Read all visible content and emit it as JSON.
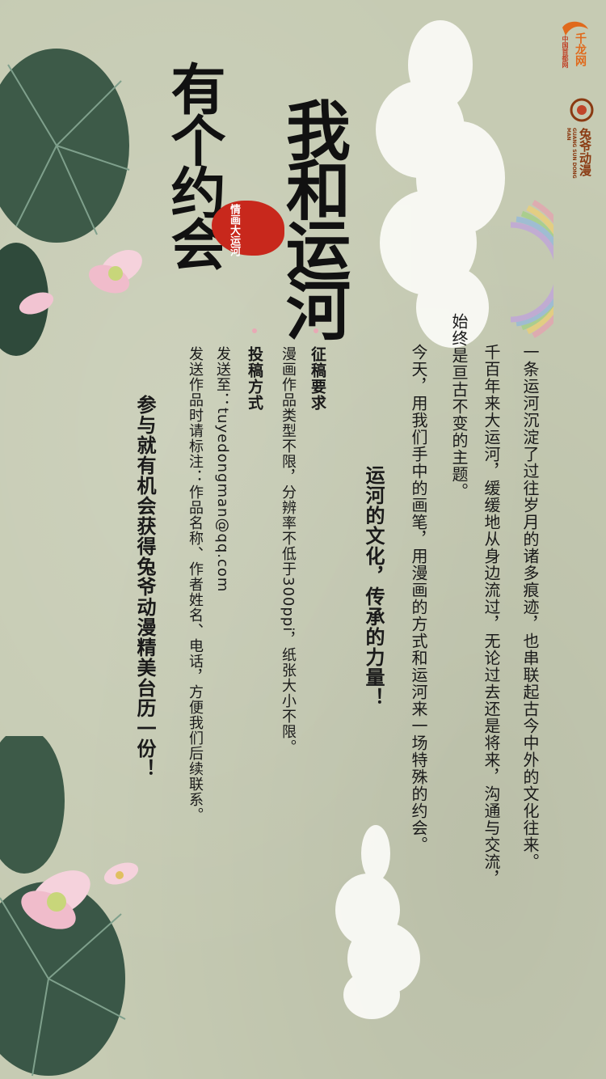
{
  "logos": {
    "qianlong": {
      "name": "千龙网",
      "sub": "中国首都网",
      "color": "#e06a1c"
    },
    "tuye": {
      "name": "兔爷动漫",
      "sub": "GUANG SUN DONG MAN",
      "color": "#8a3a12"
    }
  },
  "title": {
    "line1": "我和运河",
    "line2": "有个约会",
    "seal": "情画大运河"
  },
  "body": {
    "p1": "一条运河沉淀了过往岁月的诸多痕迹，也串联起古今中外的文化往来。",
    "p2a": "千百年来大运河，缓缓地从身边流过，无论过去还是将来，沟通与交流，",
    "p2b": "始终是亘古不变的主题。",
    "p3": "今天，用我们手中的画笔，用漫画的方式和运河来一场特殊的约会。",
    "slogan": "运河的文化，传承的力量！"
  },
  "requirements": {
    "heading": "征稿要求",
    "text": "漫画作品类型不限，分辨率不低于300ppi，纸张大小不限。"
  },
  "submission": {
    "heading": "投稿方式",
    "line1": "发送至：tuyedongman@qq.com",
    "line2": "发送作品时请标注：作品名称、作者姓名、电话，方便我们后续联系。"
  },
  "footer": "参与就有机会获得兔爷动漫精美台历一份！",
  "colors": {
    "background": "#c6cbb3",
    "leaf": "#3d5a48",
    "lotus": "#f2c4d2",
    "seal": "#c8281c",
    "bullet": "#e8a9b5"
  }
}
